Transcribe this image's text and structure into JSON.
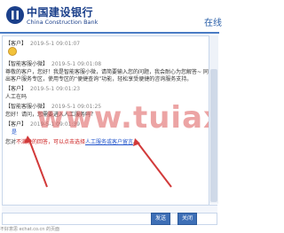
{
  "header": {
    "bank_name_cn": "中国建设银行",
    "bank_name_en": "China Construction Bank",
    "right_label": "在线"
  },
  "watermark": "www.tuiaxc.cn",
  "messages": [
    {
      "sender": "【客户】",
      "time": "2019-5-1   09:01:07",
      "lines": []
    },
    {
      "sender": "【智能客服小微】",
      "time": "2019-5-1   09:01:08",
      "lines": [
        "尊敬的客户，您好！我是智能客服小微，请简要输入您的问题，我会耐心为您解答~ 同时，同站已推",
        "出客户服务专区，使用专区的“便捷查询”功能，轻松享受便捷的咨询服务支持。"
      ]
    },
    {
      "sender": "【客户】",
      "time": "2019-5-1   09:01:23",
      "lines": [
        "人工在吗"
      ]
    },
    {
      "sender": "【智能客服小微】",
      "time": "2019-5-1   09:01:25",
      "lines": [
        "您好！请问，您需要进入人工服务吗？"
      ]
    },
    {
      "sender": "【客户】",
      "time": "2019-5-1   09:01:39",
      "lines": [
        "是"
      ]
    },
    {
      "sender": "",
      "time": "",
      "lines": []
    }
  ],
  "notice": {
    "prefix": "您对",
    "red_text": "不满意的回答，可以点击选择",
    "link_text": "人工服务或客户留言",
    "suffix": "。"
  },
  "buttons": {
    "send": "发送",
    "close": "关闭"
  },
  "footer": "不好意思 echat.co.cn 的页面"
}
